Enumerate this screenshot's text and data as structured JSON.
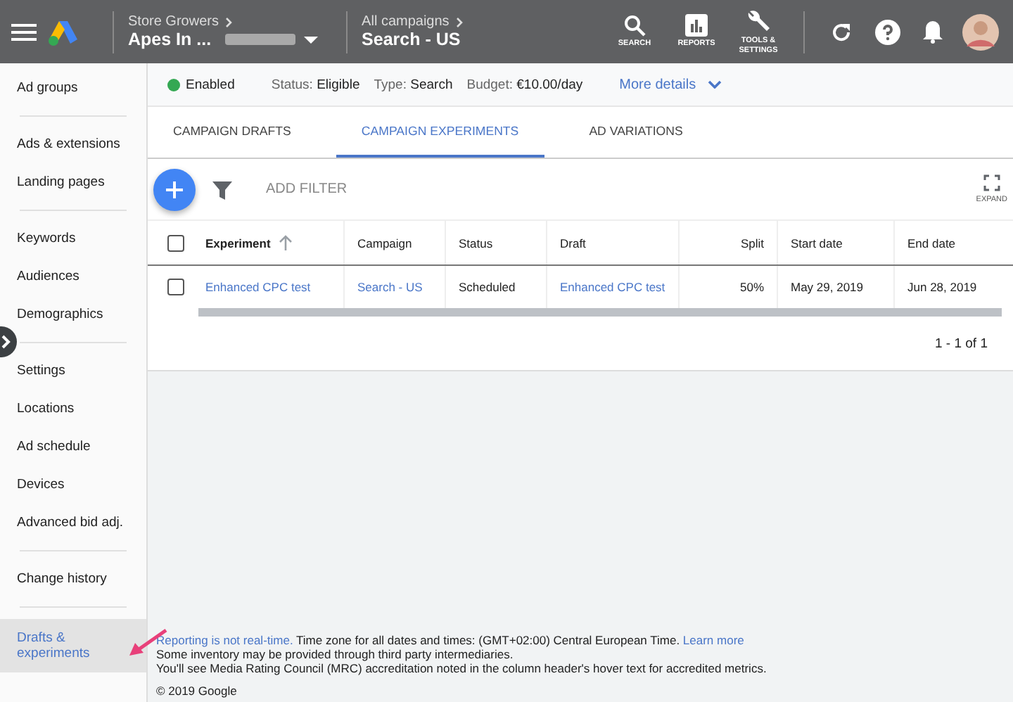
{
  "header": {
    "account_label": "Store Growers",
    "account_name": "Apes In ...",
    "campaign_label": "All campaigns",
    "campaign_name": "Search - US",
    "tools": [
      {
        "kind": "search",
        "label": "SEARCH"
      },
      {
        "kind": "reports",
        "label": "REPORTS"
      },
      {
        "kind": "tools",
        "label": "TOOLS & SETTINGS"
      }
    ]
  },
  "sidebar": {
    "groups": [
      [
        {
          "label": "Ad groups",
          "selected": false
        }
      ],
      [
        {
          "label": "Ads & extensions",
          "selected": false
        },
        {
          "label": "Landing pages",
          "selected": false
        }
      ],
      [
        {
          "label": "Keywords",
          "selected": false
        },
        {
          "label": "Audiences",
          "selected": false
        },
        {
          "label": "Demographics",
          "selected": false
        }
      ],
      [
        {
          "label": "Settings",
          "selected": false
        },
        {
          "label": "Locations",
          "selected": false
        },
        {
          "label": "Ad schedule",
          "selected": false
        },
        {
          "label": "Devices",
          "selected": false
        },
        {
          "label": "Advanced bid adj.",
          "selected": false
        }
      ],
      [
        {
          "label": "Change history",
          "selected": false
        }
      ],
      [
        {
          "label": "Drafts & experiments",
          "selected": true
        }
      ]
    ]
  },
  "summary": {
    "state": "Enabled",
    "color": "#34a853",
    "fields": [
      {
        "label": "Status:",
        "value": "Eligible"
      },
      {
        "label": "Type:",
        "value": "Search"
      },
      {
        "label": "Budget:",
        "value": "€10.00/day"
      }
    ],
    "more": "More details"
  },
  "tabs": [
    {
      "label": "CAMPAIGN DRAFTS",
      "selected": false
    },
    {
      "label": "CAMPAIGN EXPERIMENTS",
      "selected": true
    },
    {
      "label": "AD VARIATIONS",
      "selected": false
    }
  ],
  "toolbar": {
    "filter": "ADD FILTER",
    "expand": "EXPAND"
  },
  "table": {
    "all_checked": false,
    "columns": [
      {
        "label": "Experiment",
        "sorted": true
      },
      {
        "label": "Campaign",
        "sorted": false
      },
      {
        "label": "Status",
        "sorted": false
      },
      {
        "label": "Draft",
        "sorted": false
      },
      {
        "label": "Split",
        "sorted": false
      },
      {
        "label": "Start date",
        "sorted": false
      },
      {
        "label": "End date",
        "sorted": false
      }
    ],
    "rows": [
      {
        "checked": false,
        "cells": [
          {
            "text": "Enhanced CPC test",
            "kind": "link"
          },
          {
            "text": "Search - US",
            "kind": "link"
          },
          {
            "text": "Scheduled",
            "kind": "text"
          },
          {
            "text": "Enhanced CPC test",
            "kind": "link"
          },
          {
            "text": "50%",
            "kind": "number"
          },
          {
            "text": "May 29, 2019",
            "kind": "text"
          },
          {
            "text": "Jun 28, 2019",
            "kind": "text"
          }
        ]
      }
    ],
    "pagination": "1 - 1 of 1"
  },
  "footer": {
    "realtime_link": "Reporting is not real-time.",
    "timezone": "Time zone for all dates and times: (GMT+02:00) Central European Time.",
    "learn_more": "Learn more",
    "lines": [
      "Some inventory may be provided through third party intermediaries.",
      "You'll see Media Rating Council (MRC) accreditation noted in the column header's hover text for accredited metrics."
    ],
    "copyright": "© 2019 Google"
  }
}
